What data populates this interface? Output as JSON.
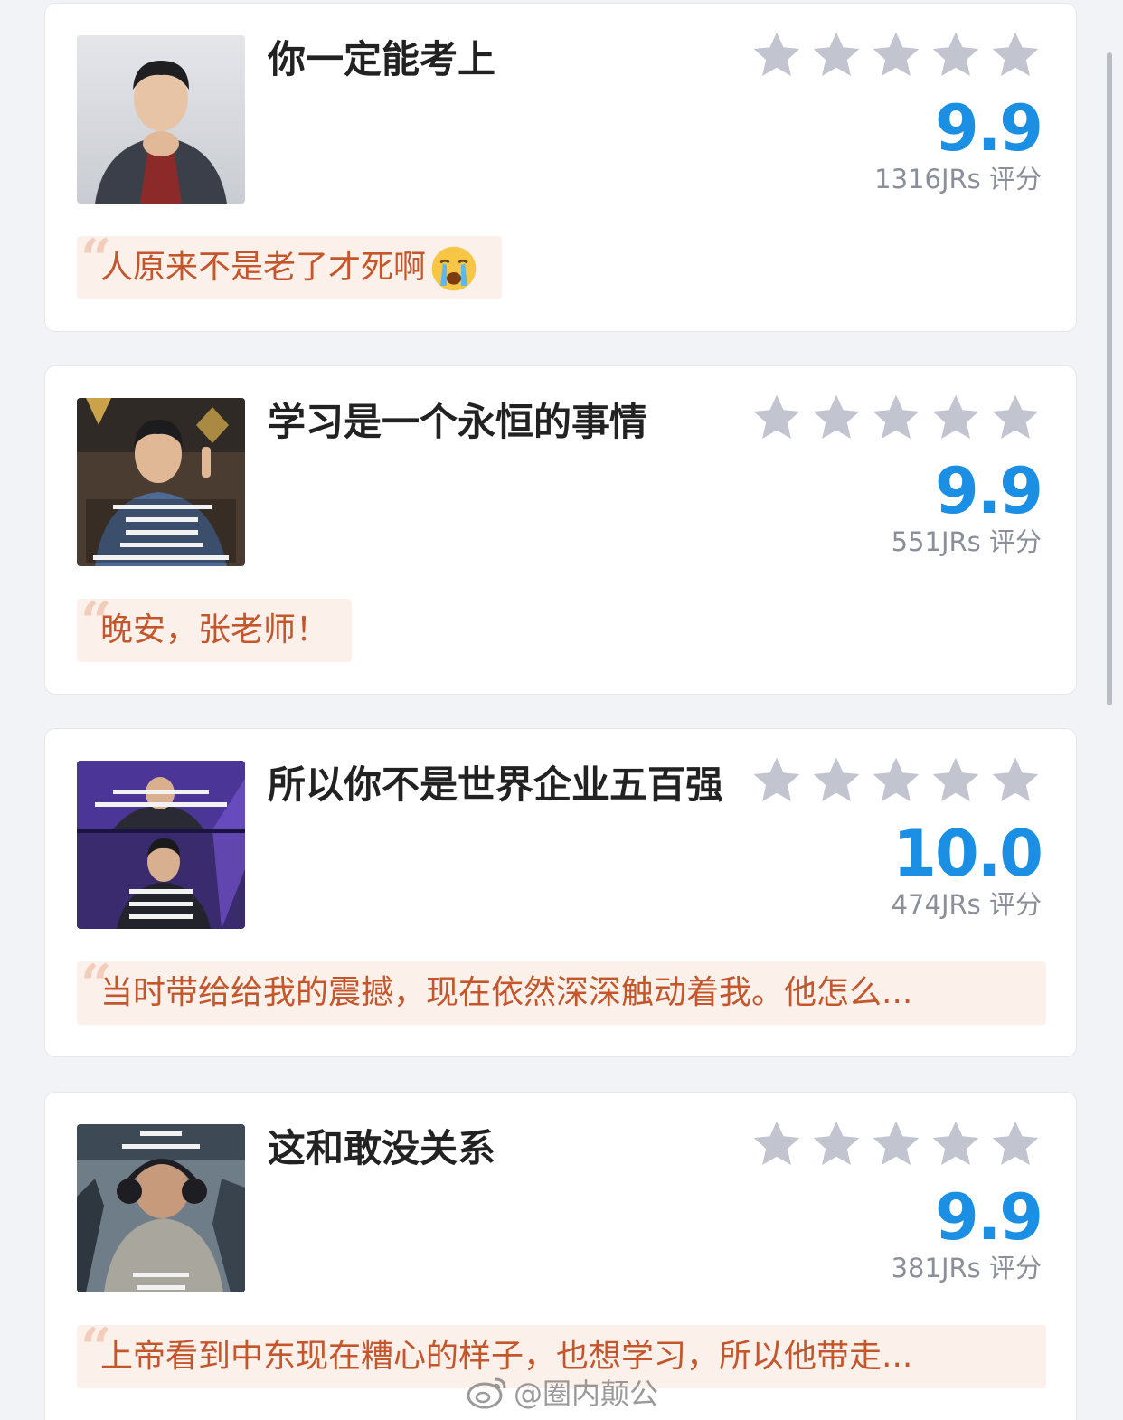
{
  "items": [
    {
      "title": "你一定能考上",
      "score": "9.9",
      "rating_count": "1316JRs 评分",
      "stars": 5,
      "comment": "人原来不是老了才死啊",
      "comment_emoji": "crying-face-icon",
      "thumbnail": "portrait-man-in-suit"
    },
    {
      "title": "学习是一个永恒的事情",
      "score": "9.9",
      "rating_count": "551JRs 评分",
      "stars": 5,
      "comment": "晚安，张老师！",
      "thumbnail": "video-frame-man-pointing-with-subtitles"
    },
    {
      "title": "所以你不是世界企业五百强",
      "score": "10.0",
      "rating_count": "474JRs 评分",
      "stars": 5,
      "comment": "当时带给给我的震撼，现在依然深深触动着我。他怎么...",
      "thumbnail": "video-frame-stage-speech-purple"
    },
    {
      "title": "这和敢没关系",
      "score": "9.9",
      "rating_count": "381JRs 评分",
      "stars": 5,
      "comment": "上帝看到中东现在糟心的样子，也想学习，所以他带走...",
      "thumbnail": "video-frame-man-outdoors-winter"
    }
  ],
  "watermark": "@圈内颠公",
  "colors": {
    "score": "#1a8fe3",
    "star": "#c2c5cf",
    "comment_text": "#c4562c",
    "comment_bg": "#fcf0ea"
  }
}
